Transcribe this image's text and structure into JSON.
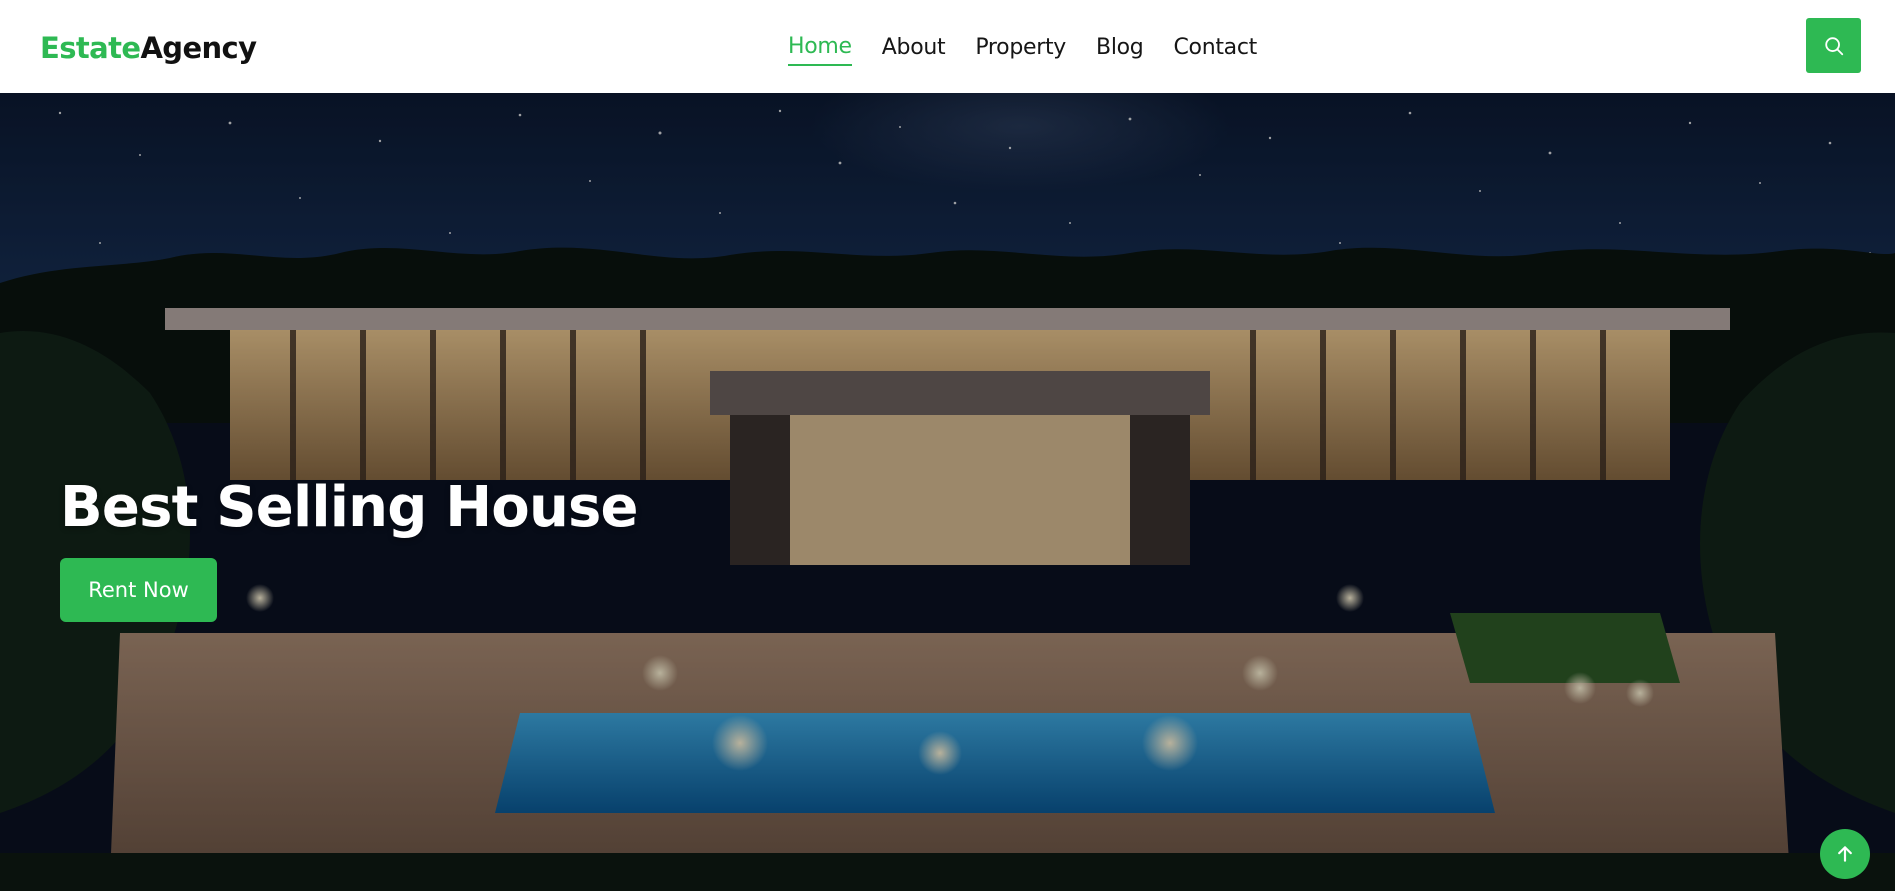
{
  "header": {
    "logo": {
      "accent_part": "Estate",
      "main_part": "Agency"
    },
    "nav": [
      {
        "label": "Home",
        "active": true
      },
      {
        "label": "About",
        "active": false
      },
      {
        "label": "Property",
        "active": false
      },
      {
        "label": "Blog",
        "active": false
      },
      {
        "label": "Contact",
        "active": false
      }
    ],
    "search_icon": "search-icon"
  },
  "hero": {
    "title": "Best Selling House",
    "cta_label": "Rent Now",
    "background_image": "night-view-of-modern-villa-with-pool"
  },
  "floating": {
    "back_to_top_icon": "arrow-up-icon"
  },
  "colors": {
    "accent": "#2eb953",
    "header_bg": "#ffffff",
    "nav_text": "#161616",
    "hero_text": "#ffffff"
  }
}
